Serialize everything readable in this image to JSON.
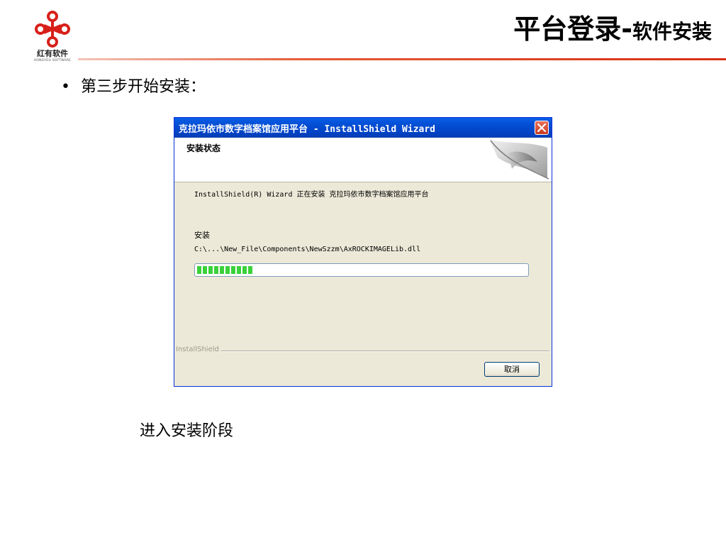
{
  "slide": {
    "logo_cn": "红有软件",
    "logo_en": "HONGYOU SOFTWARE",
    "title_main": "平台登录-",
    "title_sub": "软件安装",
    "bullet_text": "第三步开始安装：",
    "caption": "进入安装阶段"
  },
  "dialog": {
    "title": "克拉玛依市数字档案馆应用平台 - InstallShield Wizard",
    "header_title": "安装状态",
    "status_line": "InstallShield(R) Wizard 正在安装 克拉玛依市数字档案馆应用平台",
    "action_label": "安装",
    "current_file": "C:\\...\\New_File\\Components\\NewSzzm\\AxROCKIMAGELib.dll",
    "progress_fraction": 0.17,
    "footer_brand": "InstallShield",
    "cancel_label": "取消"
  },
  "colors": {
    "accent_red": "#d83014",
    "titlebar_blue": "#0450d6",
    "progress_green": "#3ad13a"
  }
}
